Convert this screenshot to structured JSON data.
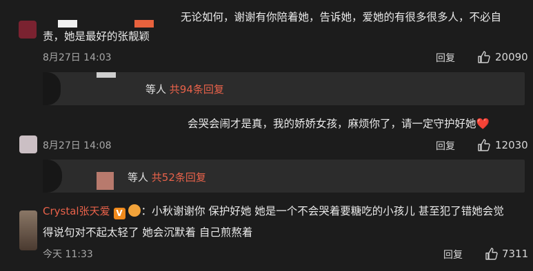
{
  "comments": [
    {
      "text_line1": "无论如何，谢谢有你陪着她，告诉她，爱她的有很多很多人，不必自",
      "text_line2": "责，她是最好的张靓颖",
      "time": "8月27日 14:03",
      "reply_label": "回复",
      "likes": "20090",
      "sub": {
        "prefix": "等人",
        "count": "共94条回复"
      }
    },
    {
      "text": "会哭会闹才是真，我的娇娇女孩，麻烦你了，请一定守护好她",
      "emoji": "❤️",
      "time": "8月27日 14:08",
      "reply_label": "回复",
      "likes": "12030",
      "sub": {
        "prefix": "等人",
        "count": "共52条回复"
      }
    },
    {
      "name": "Crystal张天爱",
      "badge": "V",
      "text_line1": "：小秋谢谢你 保护好她 她是一个不会哭着要糖吃的小孩儿 甚至犯了错她会觉",
      "text_line2": "得说句对不起太轻了 她会沉默着 自己煎熬着",
      "time": "今天 11:33",
      "reply_label": "回复",
      "likes": "7311"
    }
  ],
  "colors": {
    "accent": "#e9624a",
    "background": "#1c1c1c",
    "panel": "#2c2c2c"
  }
}
